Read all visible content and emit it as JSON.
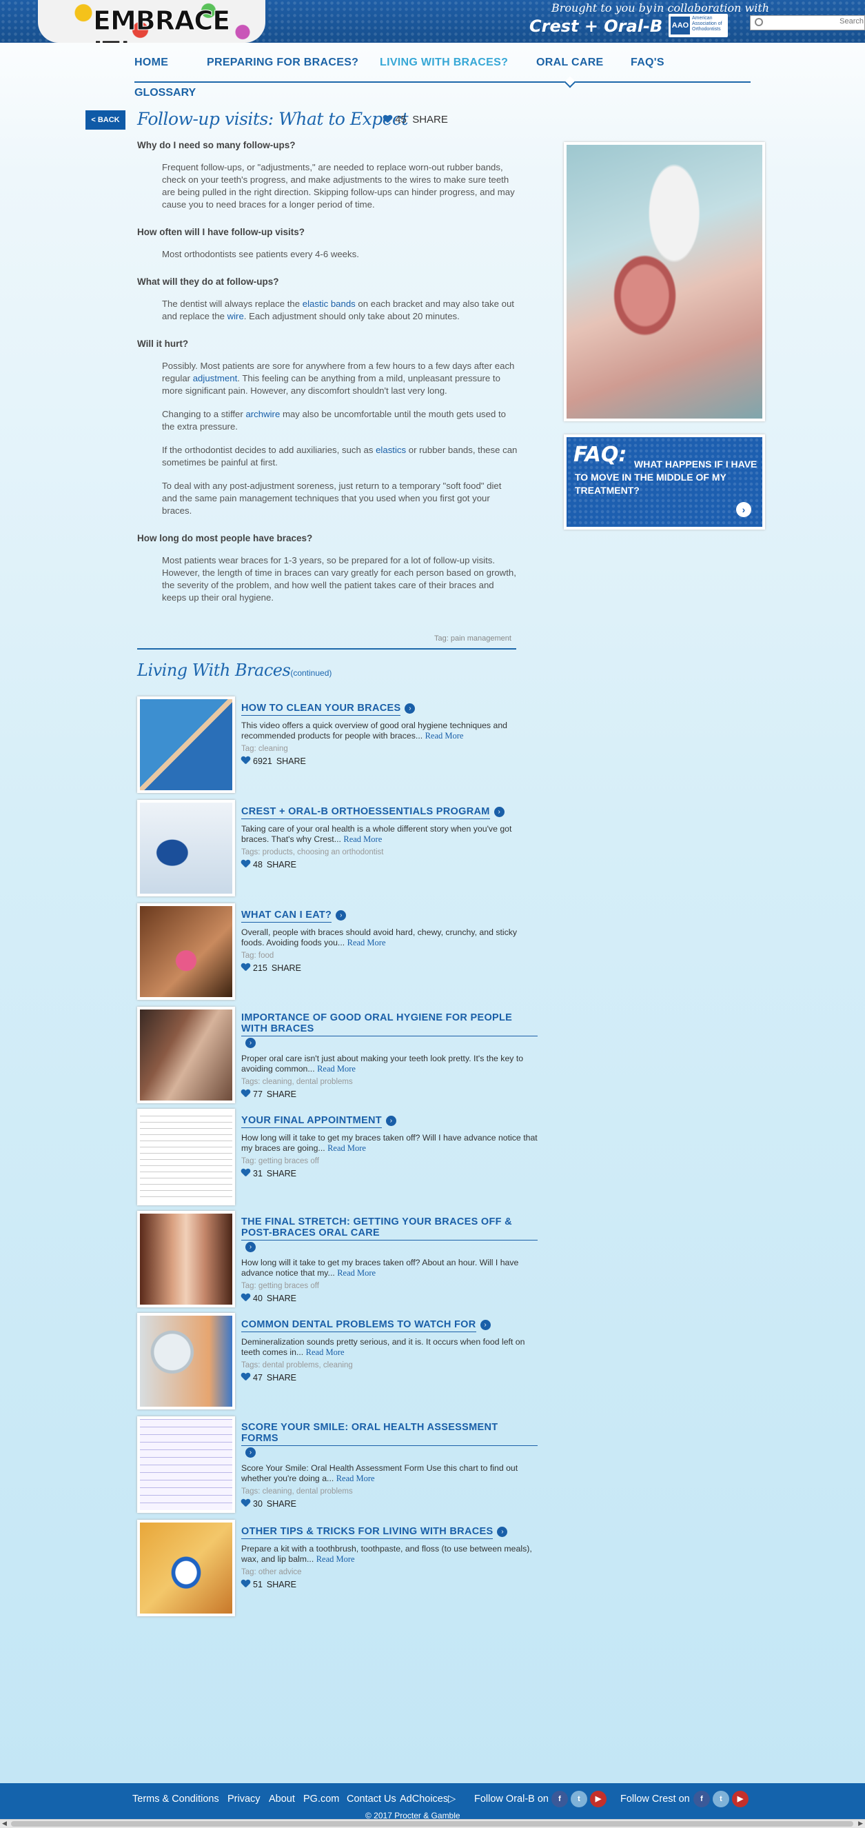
{
  "header": {
    "logo_text": "EMBRACE IT!",
    "brought_by": "Brought to you by",
    "brands": "Crest + Oral-B",
    "collab": "in collaboration with",
    "aao": "American Association of Orthodontists",
    "aao_mark": "AAO",
    "search_placeholder": "Search"
  },
  "nav": {
    "items": [
      "HOME",
      "PREPARING FOR BRACES?",
      "LIVING WITH BRACES?",
      "ORAL CARE",
      "FAQ'S"
    ],
    "glossary": "GLOSSARY",
    "active": "LIVING WITH BRACES?"
  },
  "article": {
    "back": "< BACK",
    "title": "Follow-up visits: What to Expect",
    "likes": "45",
    "share": "SHARE",
    "q1": "Why do I need so many follow-ups?",
    "a1": "Frequent follow-ups, or \"adjustments,\" are needed to replace worn-out rubber bands, check on your teeth's progress, and make adjustments to the wires to make sure teeth are being pulled in the right direction. Skipping follow-ups can hinder progress, and may cause you to need braces for a longer period of time.",
    "q2": "How often will I have follow-up visits?",
    "a2": "Most orthodontists see patients every 4-6 weeks.",
    "q3": "What will they do at follow-ups?",
    "a3_pre": "The dentist will always replace the ",
    "a3_link1": "elastic bands",
    "a3_mid": " on each bracket and may also take out and replace the ",
    "a3_link2": "wire",
    "a3_post": ". Each adjustment should only take about 20 minutes.",
    "q4": "Will it hurt?",
    "a4a_pre": "Possibly. Most patients are sore for anywhere from a few hours to a few days after each regular ",
    "a4a_link": "adjustment",
    "a4a_post": ". This feeling can be anything from a mild, unpleasant pressure to more significant pain. However, any discomfort shouldn't last very long.",
    "a4b_pre": "Changing to a stiffer ",
    "a4b_link": "archwire",
    "a4b_post": " may also be uncomfortable until the mouth gets used to the extra pressure.",
    "a4c_pre": "If the orthodontist decides to add auxiliaries, such as ",
    "a4c_link": "elastics",
    "a4c_post": " or rubber bands, these can sometimes be painful at first.",
    "a4d": "To deal with any post-adjustment soreness, just return to a temporary \"soft food\" diet and the same pain management techniques that you used when you first got your braces.",
    "q5": "How long do most people have braces?",
    "a5": "Most patients wear braces for 1-3 years, so be prepared for a lot of follow-up visits. However, the length of time in braces can vary greatly for each person based on growth, the severity of the problem, and how well the patient takes care of their braces and keeps up their oral hygiene.",
    "tag": "Tag: pain management"
  },
  "sidebar": {
    "faq_label": "FAQ:",
    "faq_text": "WHAT HAPPENS IF I HAVE TO MOVE IN THE MIDDLE OF MY TREATMENT?",
    "faq_arrow": "›"
  },
  "related": {
    "heading": "Living With Braces",
    "continued": "(continued)",
    "read_more": "Read More",
    "share": "SHARE",
    "items": [
      {
        "title": "HOW TO CLEAN YOUR BRACES",
        "desc": "This video offers a quick overview of good oral hygiene techniques and recommended products for people with braces...",
        "tag": "Tag: cleaning",
        "likes": "6921"
      },
      {
        "title": "CREST + ORAL-B ORTHOESSENTIALS PROGRAM",
        "desc": "Taking care of your oral health is a whole different story when you've got braces. That's why Crest...",
        "tag": "Tags: products, choosing an orthodontist",
        "likes": "48"
      },
      {
        "title": "WHAT CAN I EAT?",
        "desc": "Overall, people with braces should avoid hard, chewy, crunchy, and sticky foods. Avoiding foods you...",
        "tag": "Tag: food",
        "likes": "215"
      },
      {
        "title": "IMPORTANCE OF GOOD ORAL HYGIENE FOR PEOPLE WITH BRACES",
        "desc": "Proper oral care isn't just about making your teeth look pretty. It's the key to avoiding common...",
        "tag": "Tags: cleaning, dental problems",
        "likes": "77"
      },
      {
        "title": "YOUR FINAL APPOINTMENT",
        "desc": "How long will it take to get my braces taken off? Will I have advance notice that my braces are going...",
        "tag": "Tag: getting braces off",
        "likes": "31"
      },
      {
        "title": "THE FINAL STRETCH: GETTING YOUR BRACES OFF & POST-BRACES ORAL CARE",
        "desc": "How long will it take to get my braces taken off? About an hour. Will I have advance notice that my...",
        "tag": "Tag: getting braces off",
        "likes": "40"
      },
      {
        "title": "COMMON DENTAL PROBLEMS TO WATCH FOR",
        "desc": "Demineralization sounds pretty serious, and it is. It occurs when food left on teeth comes in...",
        "tag": "Tags: dental problems, cleaning",
        "likes": "47"
      },
      {
        "title": "SCORE YOUR SMILE: ORAL HEALTH ASSESSMENT FORMS",
        "desc": "Score Your Smile: Oral Health Assessment Form Use this chart to find out whether you're doing a...",
        "tag": "Tags: cleaning, dental problems",
        "likes": "30"
      },
      {
        "title": "OTHER TIPS & TRICKS FOR LIVING WITH BRACES",
        "desc": "Prepare a kit with a toothbrush, toothpaste, and floss (to use between meals), wax, and lip balm...",
        "tag": "Tag: other advice",
        "likes": "51"
      }
    ]
  },
  "footer": {
    "links": [
      "Terms & Conditions",
      "Privacy",
      "About",
      "PG.com",
      "Contact Us",
      "AdChoices▷"
    ],
    "follow_oralb": "Follow Oral-B on",
    "follow_crest": "Follow Crest on",
    "copyright": "© 2017 Procter & Gamble",
    "social_colors": {
      "facebook": "#3b5998",
      "twitter": "#7fb2d8",
      "youtube": "#c4302b"
    }
  }
}
